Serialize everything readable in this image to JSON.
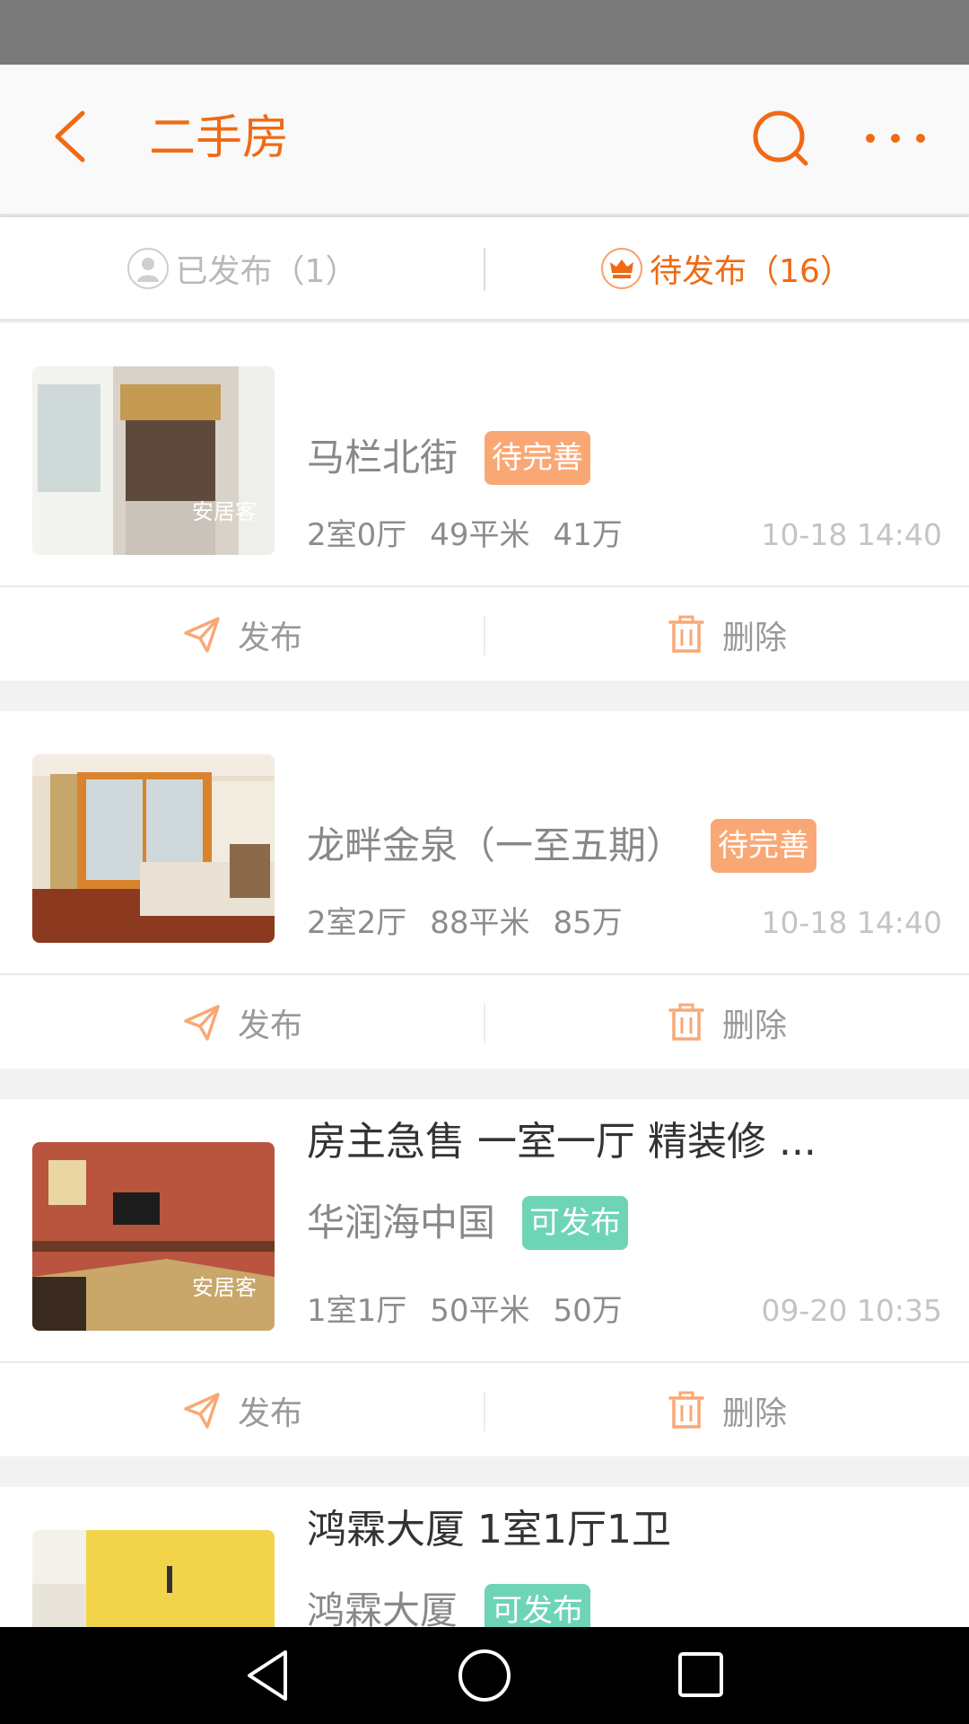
{
  "app_bar": {
    "title": "二手房",
    "icons": {
      "back": "chevron-left-icon",
      "search": "search-icon",
      "more": "more-horizontal-icon"
    }
  },
  "tabs": [
    {
      "label": "已发布（1）",
      "icon": "user-icon",
      "active": false
    },
    {
      "label": "待发布（16）",
      "icon": "crown-icon",
      "active": true
    }
  ],
  "listings": [
    {
      "headline": "",
      "name": "马栏北街",
      "badge": "待完善",
      "badge_color": "#f9a875",
      "rooms": "2室0厅",
      "area": "49平米",
      "price": "41万",
      "time": "10-18 14:40",
      "watermark": "安居客"
    },
    {
      "headline": "",
      "name": "龙畔金泉（一至五期）",
      "badge": "待完善",
      "badge_color": "#f9a875",
      "rooms": "2室2厅",
      "area": "88平米",
      "price": "85万",
      "time": "10-18 14:40",
      "watermark": ""
    },
    {
      "headline": "房主急售 一室一厅 精装修 ...",
      "name": "华润海中国",
      "badge": "可发布",
      "badge_color": "#6ed4b6",
      "rooms": "1室1厅",
      "area": "50平米",
      "price": "50万",
      "time": "09-20 10:35",
      "watermark": "安居客"
    },
    {
      "headline": "鸿霖大厦 1室1厅1卫",
      "name": "鸿霖大厦",
      "badge": "可发布",
      "badge_color": "#6ed4b6",
      "rooms": "",
      "area": "",
      "price": "",
      "time": "",
      "watermark": ""
    }
  ],
  "actions": {
    "publish": "发布",
    "delete": "删除"
  },
  "colors": {
    "accent": "#f06a14",
    "accent_light": "#f9a875",
    "green_badge": "#6ed4b6"
  },
  "nav_bar": {
    "icons": [
      "back-triangle-icon",
      "home-circle-icon",
      "recents-square-icon"
    ]
  }
}
